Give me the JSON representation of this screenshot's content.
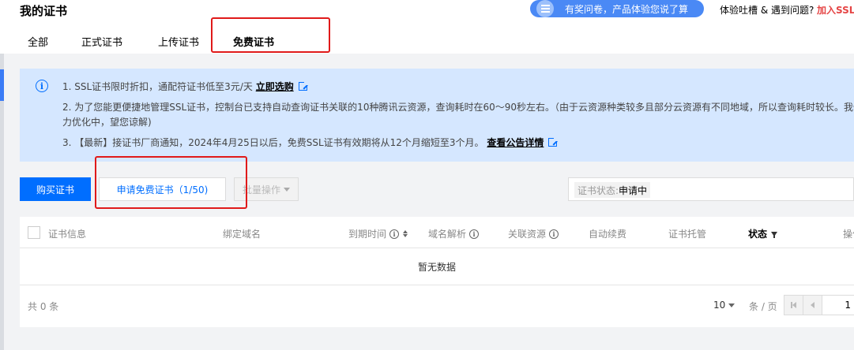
{
  "header": {
    "title": "我的证书",
    "banner_text": "有奖问卷，产品体验您说了算",
    "feedback_text": "体验吐槽 & 遇到问题?",
    "join_text": "加入SSL"
  },
  "tabs": [
    {
      "label": "全部"
    },
    {
      "label": "正式证书"
    },
    {
      "label": "上传证书"
    },
    {
      "label": "免费证书"
    }
  ],
  "notice": {
    "line1": "1. SSL证书限时折扣，通配符证书低至3元/天",
    "line1_link": "立即选购",
    "line2a": "2. 为了您能更便捷地管理SSL证书，控制台已支持自动查询证书关联的10种腾讯云资源，查询耗时在60～90秒左右。（由于云资源种类较多且部分云资源有不同地域，所以查询耗时较长。我们",
    "line2b": "力优化中，望您谅解)",
    "line3": "3. 【最新】接证书厂商通知，2024年4月25日以后，免费SSL证书有效期将从12个月缩短至3个月。",
    "line3_link": "查看公告详情"
  },
  "toolbar": {
    "buy_label": "购买证书",
    "apply_label": "申请免费证书（1/50)",
    "batch_label": "批量操作",
    "filter_key": "证书状态:",
    "filter_value": "申请中"
  },
  "table": {
    "columns": [
      "证书信息",
      "绑定域名",
      "到期时间",
      "域名解析",
      "关联资源",
      "自动续费",
      "证书托管",
      "状态",
      "操作"
    ],
    "empty_text": "暂无数据",
    "total_text": "共 0 条",
    "page_size": "10",
    "per_page_text": "条 / 页",
    "current_page": "1"
  },
  "colors": {
    "primary": "#006eff",
    "notice_bg": "#d5e7ff",
    "highlight_box": "#e01a1a",
    "banner": "#4a89f5"
  }
}
